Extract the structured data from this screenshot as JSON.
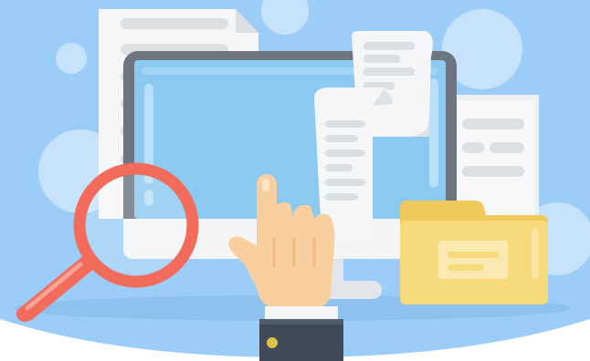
{
  "illustration": {
    "colors": {
      "background": "#9ccdf8",
      "bubble": "#c6e3fb",
      "paper": "#f4f6f8",
      "paper_line": "#dcdfe3",
      "monitor_frame": "#6c7580",
      "screen": "#8cc9f1",
      "folder": "#f7da7c",
      "magnifier": "#f36b5b",
      "skin": "#f9cf9f",
      "sleeve": "#3e4a58",
      "button": "#d8c246"
    },
    "icons": [
      "document-icon",
      "monitor-icon",
      "receipt-icon",
      "folder-icon",
      "magnifier-icon",
      "pointing-hand-icon"
    ]
  }
}
